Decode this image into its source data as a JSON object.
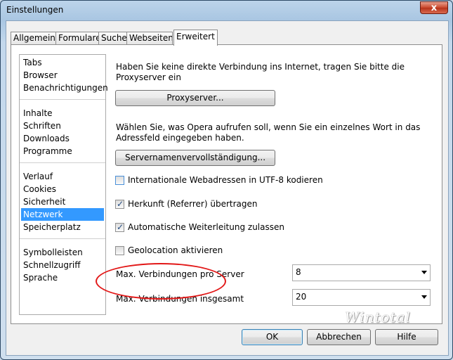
{
  "window": {
    "title": "Einstellungen",
    "close_glyph": "x"
  },
  "tabs": [
    {
      "label": "Allgemein"
    },
    {
      "label": "Formulare"
    },
    {
      "label": "Suche"
    },
    {
      "label": "Webseiten"
    },
    {
      "label": "Erweitert",
      "active": true
    }
  ],
  "sidebar": {
    "groups": [
      [
        "Tabs",
        "Browser",
        "Benachrichtigungen"
      ],
      [
        "Inhalte",
        "Schriften",
        "Downloads",
        "Programme"
      ],
      [
        "Verlauf",
        "Cookies",
        "Sicherheit",
        "Netzwerk",
        "Speicherplatz"
      ],
      [
        "Symbolleisten",
        "Schnellzugriff",
        "Sprache"
      ]
    ],
    "selected": "Netzwerk"
  },
  "network": {
    "proxy_text_line1": "Haben Sie keine direkte Verbindung ins Internet, tragen Sie bitte die",
    "proxy_text_line2": "Proxyserver ein",
    "proxy_button": "Proxyserver...",
    "servername_text_line1": "Wählen Sie, was Opera aufrufen soll, wenn Sie ein einzelnes Wort in das",
    "servername_text_line2": "Adressfeld eingegeben haben.",
    "servername_button": "Servernamenvervollständigung...",
    "checkboxes": [
      {
        "label": "Internationale Webadressen in UTF-8 kodieren",
        "checked": false
      },
      {
        "label": "Herkunft (Referrer) übertragen",
        "checked": true
      },
      {
        "label": "Automatische Weiterleitung zulassen",
        "checked": true
      },
      {
        "label": "Geolocation aktivieren",
        "checked": false
      }
    ],
    "max_per_server_label": "Max. Verbindungen pro Server",
    "max_per_server_value": "8",
    "max_total_label": "Max. Verbindungen insgesamt",
    "max_total_value": "20"
  },
  "watermark": "Wintotal",
  "footer": {
    "ok": "OK",
    "cancel": "Abbrechen",
    "help": "Hilfe"
  },
  "colors": {
    "selection": "#3399ff",
    "highlight_ring": "#e21818"
  }
}
